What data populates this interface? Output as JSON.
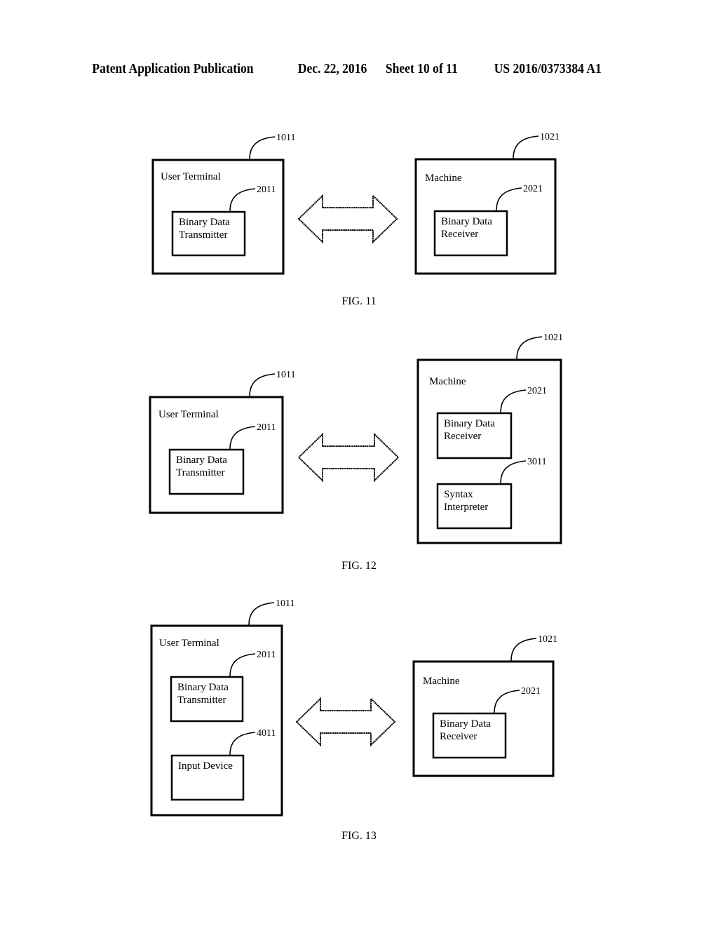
{
  "header": {
    "publication_type": "Patent Application Publication",
    "date": "Dec. 22, 2016",
    "sheet": "Sheet 10 of 11",
    "publication_number": "US 2016/0373384 A1"
  },
  "figures": [
    {
      "caption": "FIG. 11",
      "left": {
        "ref": "1011",
        "label": "User Terminal",
        "components": [
          {
            "ref": "2011",
            "lines": [
              "Binary Data",
              "Transmitter"
            ]
          }
        ]
      },
      "connector": "bidirectional-arrow",
      "right": {
        "ref": "1021",
        "label": "Machine",
        "components": [
          {
            "ref": "2021",
            "lines": [
              "Binary Data",
              "Receiver"
            ]
          }
        ]
      }
    },
    {
      "caption": "FIG. 12",
      "left": {
        "ref": "1011",
        "label": "User Terminal",
        "components": [
          {
            "ref": "2011",
            "lines": [
              "Binary Data",
              "Transmitter"
            ]
          }
        ]
      },
      "connector": "bidirectional-arrow",
      "right": {
        "ref": "1021",
        "label": "Machine",
        "components": [
          {
            "ref": "2021",
            "lines": [
              "Binary Data",
              "Receiver"
            ]
          },
          {
            "ref": "3011",
            "lines": [
              "Syntax",
              "Interpreter"
            ]
          }
        ]
      }
    },
    {
      "caption": "FIG. 13",
      "left": {
        "ref": "1011",
        "label": "User Terminal",
        "components": [
          {
            "ref": "2011",
            "lines": [
              "Binary Data",
              "Transmitter"
            ]
          },
          {
            "ref": "4011",
            "lines": [
              "Input Device"
            ]
          }
        ]
      },
      "connector": "bidirectional-arrow",
      "right": {
        "ref": "1021",
        "label": "Machine",
        "components": [
          {
            "ref": "2021",
            "lines": [
              "Binary Data",
              "Receiver"
            ]
          }
        ]
      }
    }
  ]
}
